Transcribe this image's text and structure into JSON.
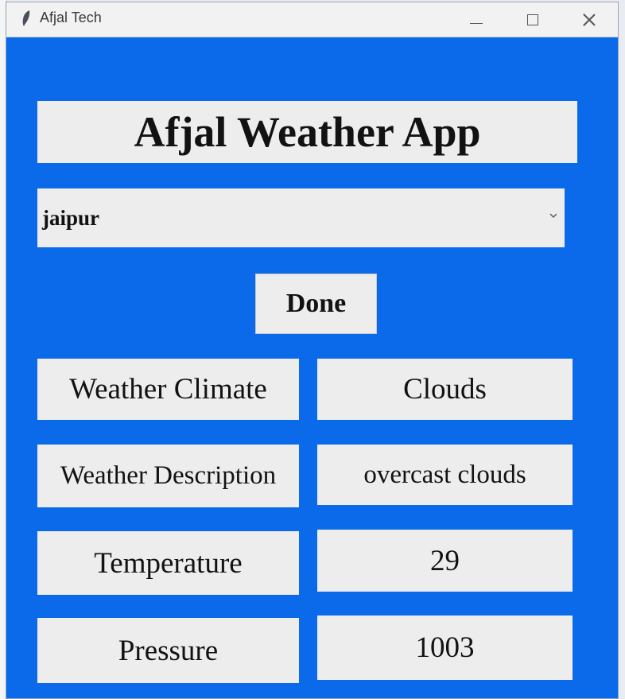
{
  "window": {
    "title": "Afjal Tech"
  },
  "app": {
    "heading": "Afjal Weather App",
    "city_selected": "jaipur",
    "done_label": "Done"
  },
  "fields": [
    {
      "label": "Weather Climate",
      "value": "Clouds"
    },
    {
      "label": "Weather Description",
      "value": "overcast clouds"
    },
    {
      "label": "Temperature",
      "value": "29"
    },
    {
      "label": "Pressure",
      "value": "1003"
    }
  ],
  "colors": {
    "window_background": "#0a6aea",
    "panel_background": "#ededee",
    "text": "#121212"
  },
  "icons": {
    "app": "feather-icon",
    "minimize": "minimize-icon",
    "maximize": "maximize-icon",
    "close": "close-icon",
    "dropdown": "chevron-down-icon"
  }
}
